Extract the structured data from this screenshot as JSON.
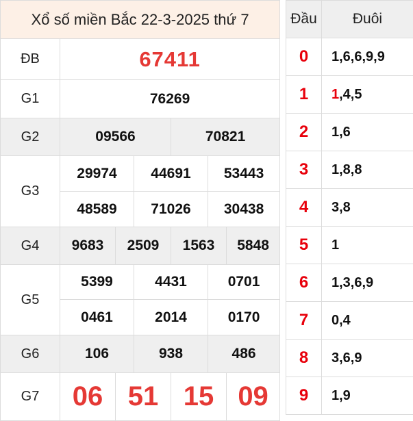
{
  "title": "Xổ số miền Bắc 22-3-2025 thứ 7",
  "labels": {
    "db": "ĐB",
    "g1": "G1",
    "g2": "G2",
    "g3": "G3",
    "g4": "G4",
    "g5": "G5",
    "g6": "G6",
    "g7": "G7"
  },
  "prizes": {
    "db": "67411",
    "g1": "76269",
    "g2": [
      "09566",
      "70821"
    ],
    "g3": [
      "29974",
      "44691",
      "53443",
      "48589",
      "71026",
      "30438"
    ],
    "g4": [
      "9683",
      "2509",
      "1563",
      "5848"
    ],
    "g5": [
      "5399",
      "4431",
      "0701",
      "0461",
      "2014",
      "0170"
    ],
    "g6": [
      "106",
      "938",
      "486"
    ],
    "g7": [
      "06",
      "51",
      "15",
      "09"
    ]
  },
  "loto": {
    "head_label": "Đầu",
    "tail_label": "Đuôi",
    "rows": [
      {
        "dau": "0",
        "hl": "",
        "rest": "1,6,6,9,9"
      },
      {
        "dau": "1",
        "hl": "1",
        "rest": ",4,5"
      },
      {
        "dau": "2",
        "hl": "",
        "rest": "1,6"
      },
      {
        "dau": "3",
        "hl": "",
        "rest": "1,8,8"
      },
      {
        "dau": "4",
        "hl": "",
        "rest": "3,8"
      },
      {
        "dau": "5",
        "hl": "",
        "rest": "1"
      },
      {
        "dau": "6",
        "hl": "",
        "rest": "1,3,6,9"
      },
      {
        "dau": "7",
        "hl": "",
        "rest": "0,4"
      },
      {
        "dau": "8",
        "hl": "",
        "rest": "3,6,9"
      },
      {
        "dau": "9",
        "hl": "",
        "rest": "1,9"
      }
    ]
  },
  "colors": {
    "accent": "#e53935",
    "header_bg": "#fdf0e6",
    "row_gray": "#efefef"
  }
}
